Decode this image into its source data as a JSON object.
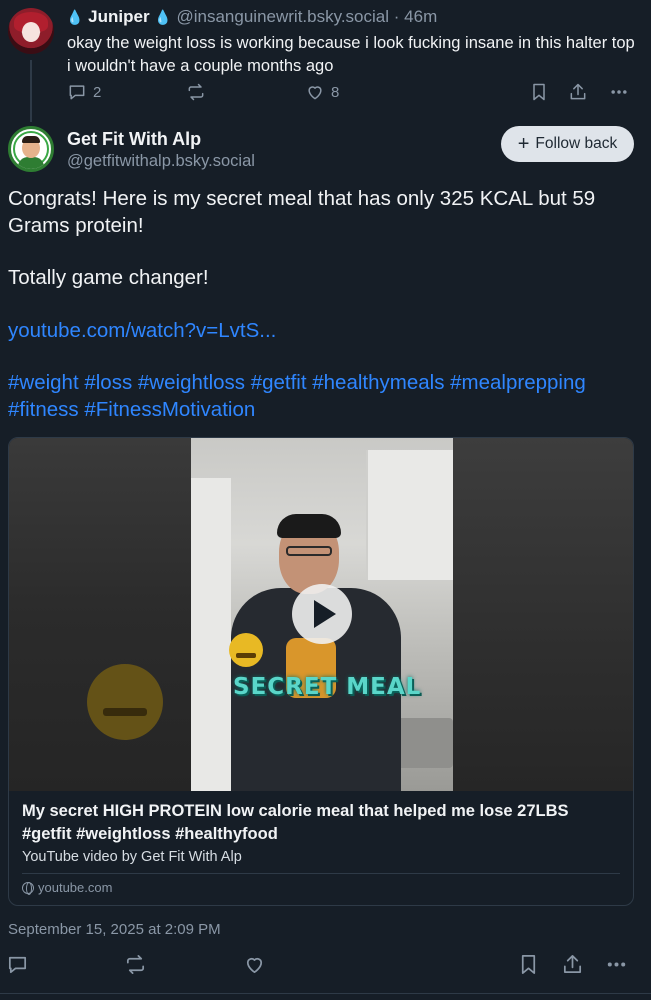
{
  "parent_post": {
    "display_name": "Juniper",
    "handle": "@insanguinewrit.bsky.social",
    "separator": "·",
    "time": "46m",
    "text": "okay the weight loss is working because i look fucking insane in this halter top i wouldn't have a couple months ago",
    "reply_count": "2",
    "repost_count": "",
    "like_count": "8"
  },
  "post": {
    "display_name": "Get Fit With Alp",
    "handle": "@getfitwithalp.bsky.social",
    "follow_label": "Follow back",
    "paragraphs": [
      "Congrats! Here is my secret meal that has only 325 KCAL but 59 Grams protein!",
      "Totally game changer!"
    ],
    "link_text": "youtube.com/watch?v=LvtS...",
    "hashtags_line1": "#weight #loss #weightloss #getfit #healthymeals #mealprepping",
    "hashtags_line2": "#fitness #FitnessMotivation",
    "timestamp": "September 15, 2025 at 2:09 PM"
  },
  "embed": {
    "thumbnail_overlay_text": "SECRET MEAL",
    "title": "My secret HIGH PROTEIN low calorie meal that helped me lose 27LBS #getfit #weightloss  #healthyfood",
    "description": "YouTube video by Get Fit With Alp",
    "domain": "youtube.com"
  },
  "icons": {
    "reply": "reply-icon",
    "repost": "repost-icon",
    "like": "like-icon",
    "bookmark": "bookmark-icon",
    "share": "share-icon",
    "more": "more-icon",
    "play": "play-icon",
    "globe": "globe-icon",
    "drop": "blood-drop-icon"
  },
  "colors": {
    "background": "#161e27",
    "text": "#f1f3f5",
    "muted": "#8a97a6",
    "link": "#2f86ff",
    "follow_button_bg": "#dfe4ea",
    "drop": "#e0252f"
  }
}
